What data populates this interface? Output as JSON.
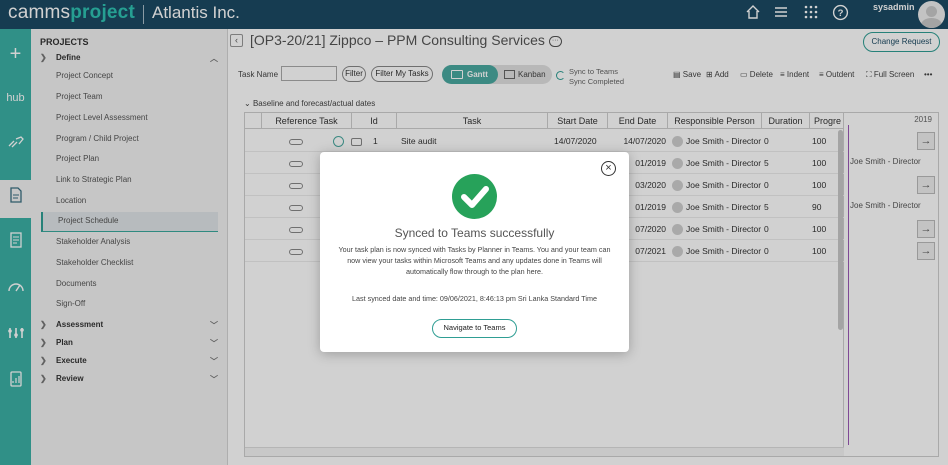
{
  "app": {
    "logo_a": "camms",
    "logo_b": "project",
    "org": "Atlantis Inc.",
    "user": "sysadmin"
  },
  "rail": [
    "plus-icon",
    "hub-icon",
    "connect-icon",
    "document-icon",
    "checklist-icon",
    "gauge-icon",
    "org-icon",
    "report-icon"
  ],
  "rail_hub": "hub",
  "sidebar": {
    "heading": "PROJECTS",
    "define_label": "Define",
    "items": [
      "Project Concept",
      "Project Team",
      "Project Level Assessment",
      "Program / Child Project",
      "Project Plan",
      "Link to Strategic Plan",
      "Location",
      "Project Schedule",
      "Stakeholder Analysis",
      "Stakeholder Checklist",
      "Documents",
      "Sign-Off"
    ],
    "selected": "Project Schedule",
    "sections": [
      "Assessment",
      "Plan",
      "Execute",
      "Review"
    ]
  },
  "page": {
    "title": "[OP3-20/21] Zippco – PPM Consulting Services",
    "change_request": "Change Request"
  },
  "toolbar": {
    "task_name_label": "Task Name",
    "filter": "Filter",
    "filter_my": "Filter My Tasks",
    "gantt": "Gantt",
    "kanban": "Kanban",
    "sync_title": "Sync to Teams",
    "sync_status": "Sync Completed",
    "save": "Save",
    "add": "Add",
    "delete": "Delete",
    "indent": "Indent",
    "outdent": "Outdent",
    "fullscreen": "Full Screen",
    "more": "•••"
  },
  "baseline_label": "Baseline and forecast/actual dates",
  "grid": {
    "headers": [
      "Reference Task",
      "Id",
      "Task",
      "Start Date",
      "End Date",
      "Responsible Person",
      "Duration",
      "Progre"
    ],
    "rows": [
      {
        "id": "1",
        "task": "Site audit",
        "start": "14/07/2020",
        "end": "14/07/2020",
        "person": "Joe Smith - Director",
        "dur": "0",
        "prog": "100"
      },
      {
        "id": "",
        "task": "",
        "start": "",
        "end": "01/2019",
        "person": "Joe Smith - Director",
        "dur": "5",
        "prog": "100"
      },
      {
        "id": "",
        "task": "",
        "start": "",
        "end": "03/2020",
        "person": "Joe Smith - Director",
        "dur": "0",
        "prog": "100"
      },
      {
        "id": "",
        "task": "",
        "start": "",
        "end": "01/2019",
        "person": "Joe Smith - Director",
        "dur": "5",
        "prog": "90"
      },
      {
        "id": "",
        "task": "",
        "start": "",
        "end": "07/2020",
        "person": "Joe Smith - Director",
        "dur": "0",
        "prog": "100"
      },
      {
        "id": "",
        "task": "",
        "start": "",
        "end": "07/2021",
        "person": "Joe Smith - Director",
        "dur": "0",
        "prog": "100"
      }
    ]
  },
  "gantt": {
    "year": "2019",
    "bar_label": "Joe Smith - Director",
    "arrow": "→"
  },
  "modal": {
    "title": "Synced to Teams successfully",
    "body": "Your task plan is now synced with Tasks by Planner in Teams. You and your team can now view your tasks within Microsoft Teams and any updates done in Teams will automatically flow through to the plan here.",
    "sync_line": "Last synced date and time: 09/06/2021, 8:46:13 pm Sri Lanka Standard Time",
    "button": "Navigate to Teams",
    "close": "×"
  }
}
